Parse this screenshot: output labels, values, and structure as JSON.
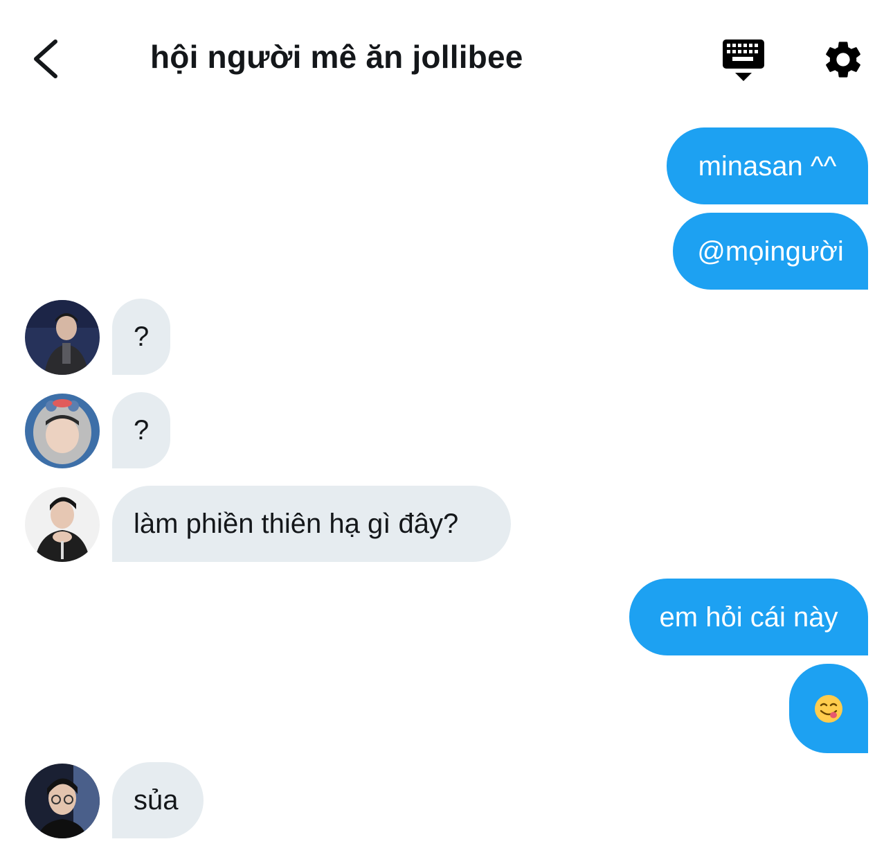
{
  "header": {
    "title": "hội người mê ăn jollibee",
    "back_icon": "chevron-left-icon",
    "keyboard_icon": "keyboard-icon",
    "settings_icon": "gear-icon"
  },
  "colors": {
    "outgoing_bubble": "#1da1f2",
    "incoming_bubble": "#e6ecf0",
    "text_dark": "#14171a"
  },
  "messages": [
    {
      "direction": "outgoing",
      "text": "minasan ^^"
    },
    {
      "direction": "outgoing",
      "text": "@mọingười"
    },
    {
      "direction": "incoming",
      "text": "?"
    },
    {
      "direction": "incoming",
      "text": "?"
    },
    {
      "direction": "incoming",
      "text": "làm phiền thiên hạ gì đây?"
    },
    {
      "direction": "outgoing",
      "text": "em hỏi cái này"
    },
    {
      "direction": "outgoing",
      "text": "",
      "emoji": "yum-face-emoji"
    },
    {
      "direction": "incoming",
      "text": "sủa"
    }
  ]
}
